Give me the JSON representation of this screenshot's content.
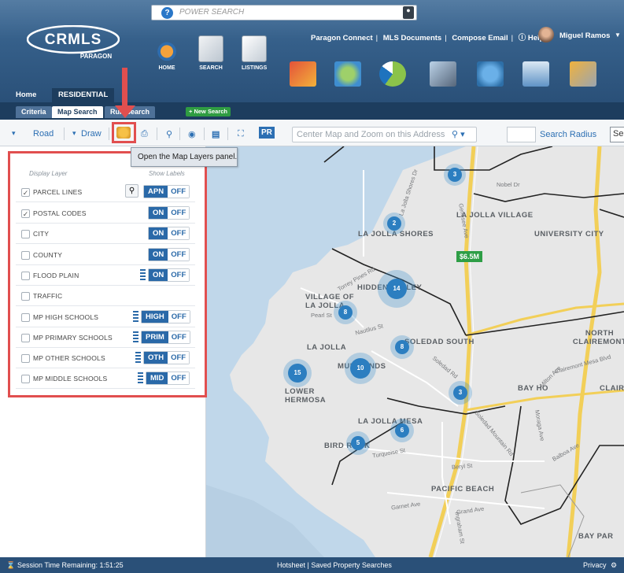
{
  "powersearch": {
    "placeholder": "POWER SEARCH",
    "help": "?"
  },
  "logo": {
    "brand": "CRMLS",
    "sub": "PARAGON"
  },
  "toplinks": [
    "Paragon Connect",
    "MLS Documents",
    "Compose Email",
    "Help"
  ],
  "user": {
    "name": "Miguel Ramos"
  },
  "nav": [
    {
      "label": "HOME"
    },
    {
      "label": "SEARCH"
    },
    {
      "label": "LISTINGS"
    }
  ],
  "tabs": {
    "home": "Home",
    "residential": "RESIDENTIAL"
  },
  "subtabs": {
    "criteria": "Criteria",
    "map": "Map Search",
    "run": "Run Search",
    "new": "+ New Search"
  },
  "toolbar": {
    "road": "Road",
    "draw": "Draw",
    "pr": "PR",
    "addr_placeholder": "Center Map and Zoom on this Address",
    "radius": "Search Radius",
    "se": "Se"
  },
  "tooltip": "Open the Map Layers panel.",
  "panel": {
    "display_layer": "Display Layer",
    "show_labels": "Show Labels",
    "layers": [
      {
        "name": "PARCEL LINES",
        "checked": true,
        "on": "APN",
        "off": "OFF"
      },
      {
        "name": "POSTAL CODES",
        "checked": true,
        "on": "ON",
        "off": "OFF"
      },
      {
        "name": "CITY",
        "checked": false,
        "on": "ON",
        "off": "OFF"
      },
      {
        "name": "COUNTY",
        "checked": false,
        "on": "ON",
        "off": "OFF"
      },
      {
        "name": "FLOOD PLAIN",
        "checked": false,
        "on": "ON",
        "off": "OFF"
      },
      {
        "name": "TRAFFIC",
        "checked": false
      },
      {
        "name": "MP HIGH SCHOOLS",
        "checked": false,
        "on": "HIGH",
        "off": "OFF"
      },
      {
        "name": "MP PRIMARY SCHOOLS",
        "checked": false,
        "on": "PRIM",
        "off": "OFF"
      },
      {
        "name": "MP OTHER SCHOOLS",
        "checked": false,
        "on": "OTH",
        "off": "OFF"
      },
      {
        "name": "MP MIDDLE SCHOOLS",
        "checked": false,
        "on": "MID",
        "off": "OFF"
      }
    ]
  },
  "map": {
    "labels": [
      "LA JOLLA SHORES",
      "LA JOLLA VILLAGE",
      "UNIVERSITY CITY",
      "HIDDEN VALLEY",
      "VILLAGE OF LA JOLLA",
      "LA JOLLA",
      "SOLEDAD SOUTH",
      "NORTH CLAIREMONT",
      "MUIRLANDS",
      "LOWER HERMOSA",
      "BAY HO",
      "CLAIR",
      "LA JOLLA MESA",
      "BIRD ROCK",
      "PACIFIC BEACH",
      "BAY PAR"
    ],
    "streets": [
      "Nobel Dr",
      "La Jolla Shores Dr",
      "Torrey Pines Rd",
      "Pearl St",
      "Nautilus St",
      "Soledad Rd",
      "Clairemont Mesa Blvd",
      "Genesee Ave",
      "Milton Ave",
      "Balboa Ave",
      "Beryl St",
      "Turquoise St",
      "Soledad Mountain Rd",
      "Garnet Ave",
      "Grand Ave",
      "Ingraham St",
      "Moraga Ave"
    ],
    "price": "$6.5M",
    "clusters": [
      "3",
      "2",
      "14",
      "8",
      "8",
      "15",
      "10",
      "3",
      "6",
      "5"
    ]
  },
  "status": {
    "session": "Session Time Remaining: 1:51:25",
    "links": "Hotsheet  |  Saved Property Searches",
    "privacy": "Privacy"
  }
}
